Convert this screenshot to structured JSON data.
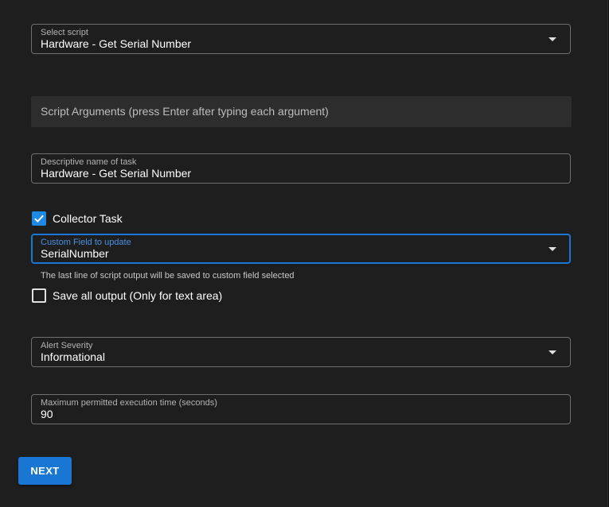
{
  "select_script": {
    "label": "Select script",
    "value": "Hardware - Get Serial Number"
  },
  "script_arguments": {
    "placeholder": "Script Arguments (press Enter after typing each argument)"
  },
  "task_name": {
    "label": "Descriptive name of task",
    "value": "Hardware - Get Serial Number"
  },
  "collector_task": {
    "label": "Collector Task",
    "checked": true
  },
  "custom_field": {
    "label": "Custom Field to update",
    "value": "SerialNumber",
    "helper": "The last line of script output will be saved to custom field selected"
  },
  "save_all_output": {
    "label": "Save all output (Only for text area)",
    "checked": false
  },
  "alert_severity": {
    "label": "Alert Severity",
    "value": "Informational"
  },
  "timeout": {
    "label": "Maximum permitted execution time (seconds)",
    "value": "90"
  },
  "actions": {
    "next_label": "NEXT"
  },
  "colors": {
    "accent": "#1976d2",
    "background": "#1e1e1e",
    "border": "#6f6f6f"
  },
  "icons": {
    "dropdown": "chevron-down-icon",
    "check": "check-icon"
  }
}
